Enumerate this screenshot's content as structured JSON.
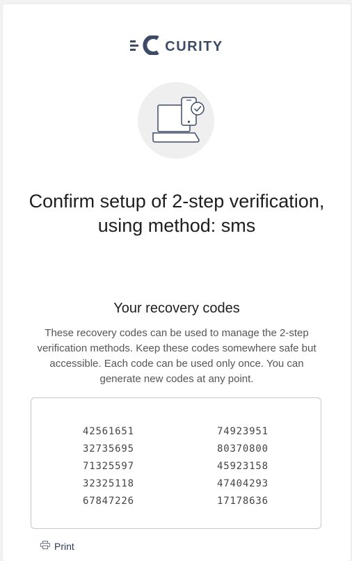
{
  "brand": {
    "name": "CURITY",
    "color": "#3d4b66",
    "logo_icon": "curity-logo-icon"
  },
  "illustration": {
    "icon": "laptop-phone-check-icon"
  },
  "page": {
    "title": "Confirm setup of 2-step verification, using method: sms"
  },
  "recovery": {
    "heading": "Your recovery codes",
    "description": "These recovery codes can be used to manage the 2-step verification methods. Keep these codes somewhere safe but accessible. Each code can be used only once. You can generate new codes at any point.",
    "codes_left": [
      "42561651",
      "32735695",
      "71325597",
      "32325118",
      "67847226"
    ],
    "codes_right": [
      "74923951",
      "80370800",
      "45923158",
      "47404293",
      "17178636"
    ]
  },
  "actions": {
    "print_label": "Print",
    "print_icon": "printer-icon"
  }
}
